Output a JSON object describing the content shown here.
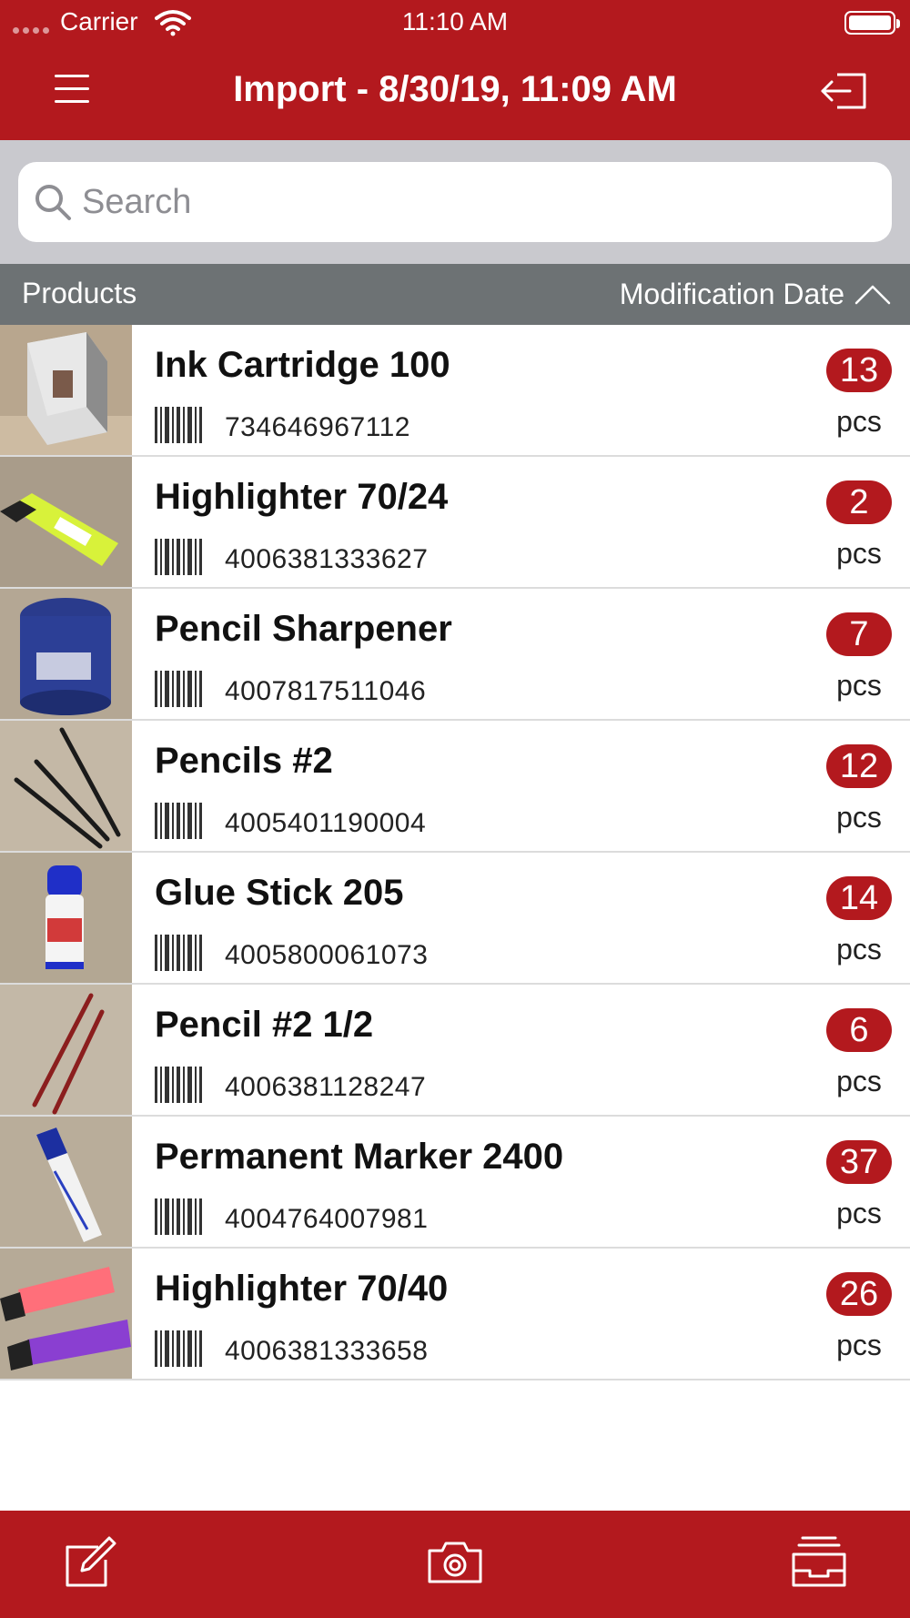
{
  "status_bar": {
    "carrier": "Carrier",
    "time": "11:10 AM"
  },
  "nav": {
    "title": "Import - 8/30/19, 11:09 AM"
  },
  "search": {
    "placeholder": "Search"
  },
  "section": {
    "left": "Products",
    "sort_label": "Modification Date"
  },
  "colors": {
    "accent": "#b3191e",
    "header_gray": "#6d7274",
    "search_bg": "#c9c9ce"
  },
  "products": [
    {
      "name": "Ink Cartridge 100",
      "code": "734646967112",
      "qty": "13",
      "unit": "pcs"
    },
    {
      "name": "Highlighter 70/24",
      "code": "4006381333627",
      "qty": "2",
      "unit": "pcs"
    },
    {
      "name": "Pencil Sharpener",
      "code": "4007817511046",
      "qty": "7",
      "unit": "pcs"
    },
    {
      "name": "Pencils #2",
      "code": "4005401190004",
      "qty": "12",
      "unit": "pcs"
    },
    {
      "name": "Glue Stick 205",
      "code": "4005800061073",
      "qty": "14",
      "unit": "pcs"
    },
    {
      "name": "Pencil #2 1/2",
      "code": "4006381128247",
      "qty": "6",
      "unit": "pcs"
    },
    {
      "name": "Permanent Marker 2400",
      "code": "4004764007981",
      "qty": "37",
      "unit": "pcs"
    },
    {
      "name": "Highlighter 70/40",
      "code": "4006381333658",
      "qty": "26",
      "unit": "pcs"
    }
  ],
  "icons": {
    "menu": "hamburger-icon",
    "exit": "exit-icon",
    "search": "magnifier-icon",
    "sort": "chevron-up-icon",
    "barcode": "barcode-icon",
    "edit": "edit-icon",
    "camera": "camera-icon",
    "inbox": "inbox-icon"
  }
}
